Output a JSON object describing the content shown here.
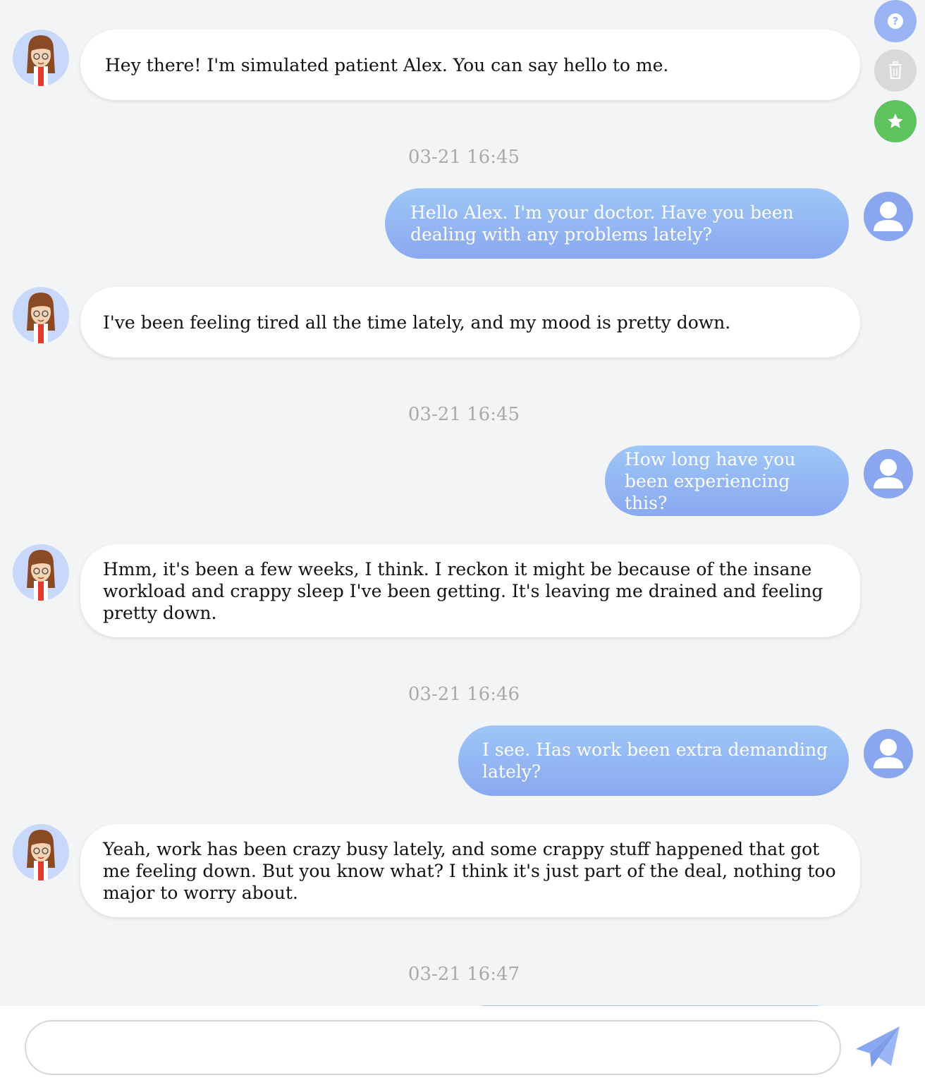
{
  "side_actions": [
    {
      "name": "help",
      "color": "#9ab3f3"
    },
    {
      "name": "delete",
      "color": "#d9d9d9"
    },
    {
      "name": "favorite",
      "color": "#5cc35d"
    }
  ],
  "messages": [
    {
      "role": "bot",
      "text": "Hey there! I'm simulated patient Alex. You can say hello to me."
    },
    {
      "role": "timestamp",
      "text": "03-21 16:45"
    },
    {
      "role": "user",
      "text": "Hello Alex. I'm your doctor. Have you been dealing with any problems lately?"
    },
    {
      "role": "bot",
      "text": "I've been feeling tired all the time lately, and my mood is pretty down."
    },
    {
      "role": "timestamp",
      "text": "03-21 16:45"
    },
    {
      "role": "user",
      "text": "How long have you been experiencing this?"
    },
    {
      "role": "bot",
      "text": "Hmm, it's been a few weeks, I think. I reckon it might be because of the insane workload and crappy sleep I've been getting. It's leaving me drained and feeling pretty down."
    },
    {
      "role": "timestamp",
      "text": "03-21 16:46"
    },
    {
      "role": "user",
      "text": "I see. Has work been extra demanding lately?"
    },
    {
      "role": "bot",
      "text": "Yeah, work has been crazy busy lately, and some crappy stuff happened that got me feeling down. But you know what? I think it's just part of the deal, nothing too major to worry about."
    },
    {
      "role": "timestamp",
      "text": "03-21 16:47"
    }
  ],
  "composer": {
    "value": "",
    "placeholder": ""
  },
  "icons": {
    "send": "paper-plane-icon",
    "help": "question-icon",
    "delete": "trash-icon",
    "favorite": "star-icon"
  }
}
